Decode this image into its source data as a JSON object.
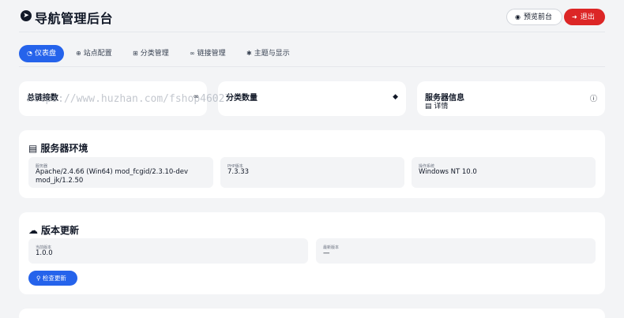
{
  "header": {
    "title": "导航管理后台",
    "logo_icon": "compass-icon",
    "preview_label": "预览前台",
    "logout_label": "退出",
    "accent": "#2563eb",
    "danger": "#dc2626"
  },
  "tabs": [
    {
      "label": "仪表盘",
      "icon": "dashboard-icon",
      "active": true
    },
    {
      "label": "站点配置",
      "icon": "globe-icon",
      "active": false
    },
    {
      "label": "分类管理",
      "icon": "sitemap-icon",
      "active": false
    },
    {
      "label": "链接管理",
      "icon": "link-icon",
      "active": false
    },
    {
      "label": "主题与显示",
      "icon": "gear-icon",
      "active": false
    }
  ],
  "stats": [
    {
      "title": "总链接数",
      "icon": "link-icon"
    },
    {
      "title": "分类数量",
      "icon": "tags-icon"
    },
    {
      "title": "服务器信息",
      "icon": "info-icon",
      "sub": "详情"
    }
  ],
  "server_env": {
    "title": "服务器环境",
    "items": [
      {
        "label": "服务器",
        "value": "Apache/2.4.66 (Win64) mod_fcgid/2.3.10-dev mod_jk/1.2.50"
      },
      {
        "label": "PHP版本",
        "value": "7.3.33"
      },
      {
        "label": "操作系统",
        "value": "Windows NT 10.0"
      }
    ]
  },
  "version": {
    "title": "版本更新",
    "items": [
      {
        "label": "当前版本",
        "value": "1.0.0"
      },
      {
        "label": "最新版本",
        "value": "—"
      }
    ],
    "check_label": "检查更新"
  },
  "watermark": "https://www.huzhan.com/fshop46027"
}
